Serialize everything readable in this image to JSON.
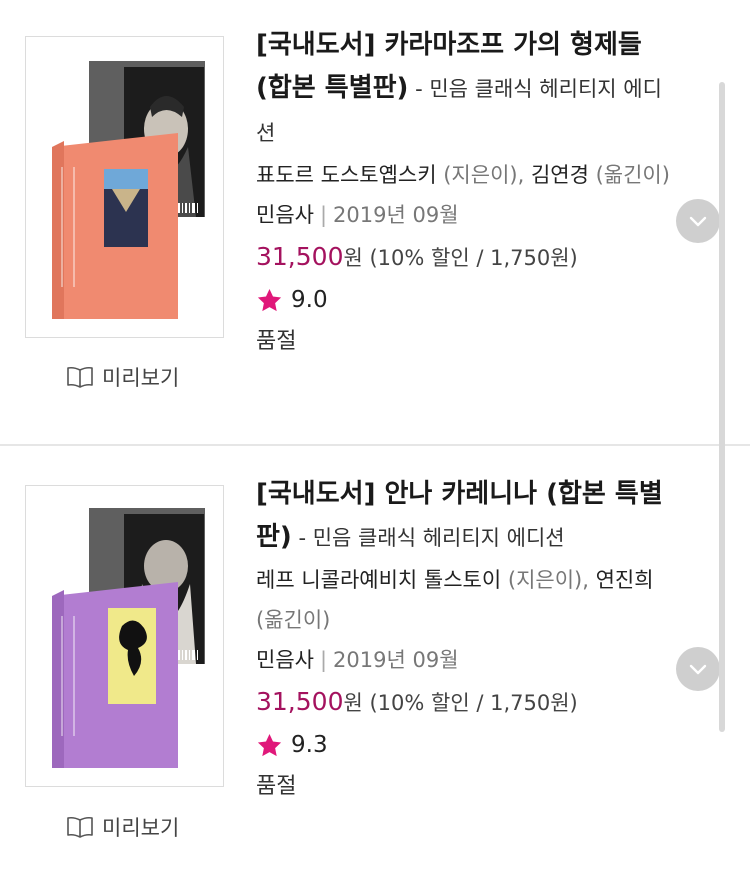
{
  "books": [
    {
      "title": "[국내도서] 카라마조프 가의 형제들 (합본 특별판)",
      "subtitle": " - 민음 클래식 헤리티지 에디션",
      "author": "표도르 도스토옙스키",
      "author_role": " (지은이), ",
      "translator": "김연경",
      "translator_role": " (옮긴이)",
      "publisher": "민음사",
      "date": "2019년 09월",
      "price": "31,500",
      "price_unit": "원",
      "discount": " (10% 할인 / 1,750원)",
      "rating": "9.0",
      "status": "품절",
      "preview_label": "미리보기",
      "cover_color": "#f08a70"
    },
    {
      "title": "[국내도서] 안나 카레니나 (합본 특별판)",
      "subtitle": " - 민음 클래식 헤리티지 에디션",
      "author": "레프 니콜라예비치 톨스토이",
      "author_role": " (지은이), ",
      "translator": "연진희",
      "translator_role": " (옮긴이)",
      "publisher": "민음사",
      "date": "2019년 09월",
      "price": "31,500",
      "price_unit": "원",
      "discount": " (10% 할인 / 1,750원)",
      "rating": "9.3",
      "status": "품절",
      "preview_label": "미리보기",
      "cover_color": "#b27dd1"
    }
  ],
  "colors": {
    "price": "#a4125e",
    "star": "#e0187a",
    "divider": "#e6e6e6"
  },
  "icons": {
    "preview": "open-book-icon",
    "rating": "star-icon",
    "more": "chevron-down-icon"
  }
}
